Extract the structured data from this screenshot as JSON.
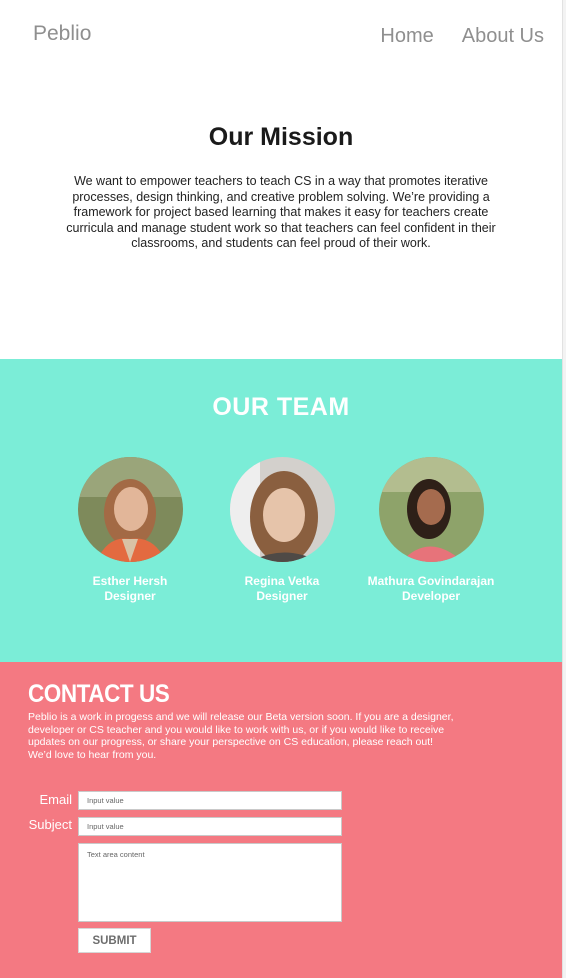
{
  "header": {
    "logo": "Peblio",
    "nav": [
      {
        "label": "Home"
      },
      {
        "label": "About Us"
      }
    ]
  },
  "mission": {
    "title": "Our Mission",
    "text": "We want to empower teachers to teach CS in a way that promotes iterative processes, design thinking, and creative problem solving. We’re providing a framework for project based learning that makes it easy for teachers create curricula and manage student work so that teachers can feel confident in their classrooms, and students can feel proud of their work."
  },
  "team": {
    "title": "OUR TEAM",
    "members": [
      {
        "name": "Esther Hersh",
        "role": "Designer"
      },
      {
        "name": "Regina Vetka",
        "role": "Designer"
      },
      {
        "name": "Mathura Govindarajan",
        "role": "Developer"
      }
    ]
  },
  "contact": {
    "title": "CONTACT US",
    "text": "Peblio is a work in progess and we will release our Beta version soon. If you are a designer, developer or CS teacher and you would like to work with us, or if you would like to receive updates on our progress, or share your perspective on CS education, please reach out! We’d love to hear from you.",
    "email_label": "Email",
    "email_placeholder": "Input value",
    "subject_label": "Subject",
    "subject_placeholder": "Input value",
    "message_placeholder": "Text area content",
    "submit_label": "SUBMIT"
  },
  "colors": {
    "team_bg": "#7bedd7",
    "contact_bg": "#f47982",
    "nav_text": "#8f8f8f"
  }
}
